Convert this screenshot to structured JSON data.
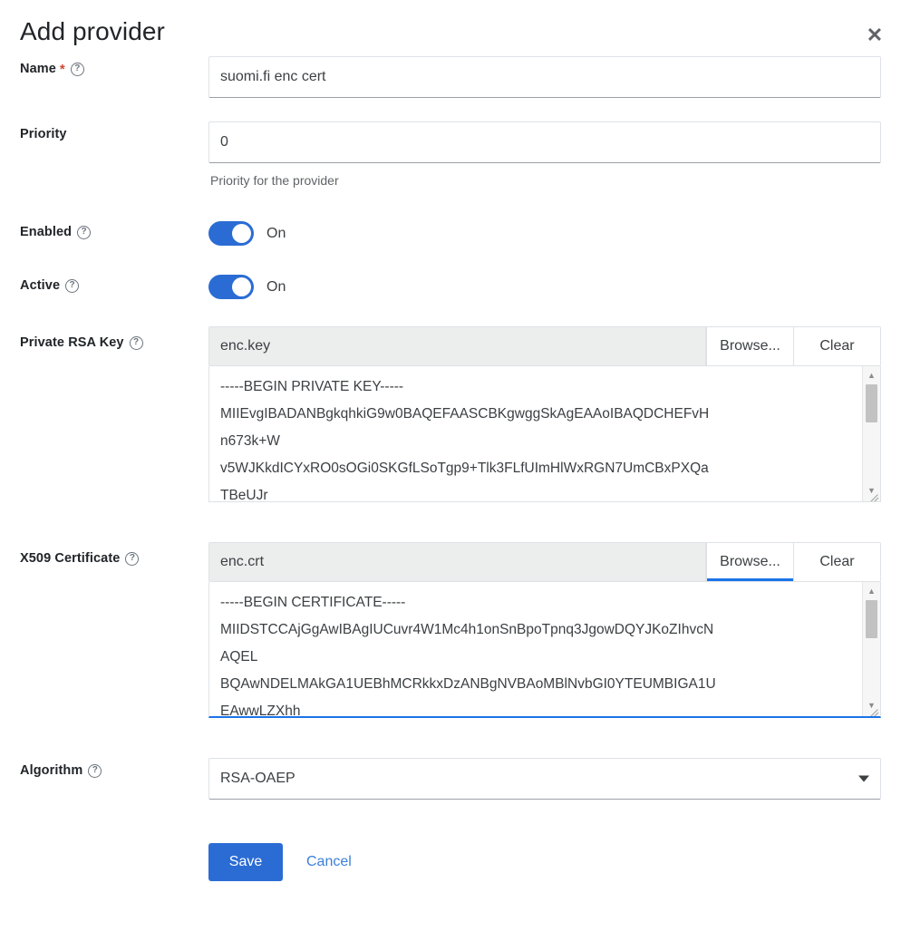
{
  "dialog": {
    "title": "Add provider",
    "close_icon": "close-icon"
  },
  "fields": {
    "name": {
      "label": "Name",
      "required_marker": "*",
      "help_icon": "help-circle-icon",
      "value": "suomi.fi enc cert"
    },
    "priority": {
      "label": "Priority",
      "value": "0",
      "hint": "Priority for the provider"
    },
    "enabled": {
      "label": "Enabled",
      "help_icon": "help-circle-icon",
      "state_label": "On",
      "checked": true
    },
    "active": {
      "label": "Active",
      "help_icon": "help-circle-icon",
      "state_label": "On",
      "checked": true
    },
    "private_rsa_key": {
      "label": "Private RSA Key",
      "help_icon": "help-circle-icon",
      "file_name": "enc.key",
      "browse_label": "Browse...",
      "clear_label": "Clear",
      "content": "-----BEGIN PRIVATE KEY-----\nMIIEvgIBADANBgkqhkiG9w0BAQEFAASCBKgwggSkAgEAAoIBAQDCHEFvH\nn673k+W\nv5WJKkdICYxRO0sOGi0SKGfLSoTgp9+Tlk3FLfUImHlWxRGN7UmCBxPXQa\nTBeUJr"
    },
    "x509_certificate": {
      "label": "X509 Certificate",
      "help_icon": "help-circle-icon",
      "file_name": "enc.crt",
      "browse_label": "Browse...",
      "clear_label": "Clear",
      "content": "-----BEGIN CERTIFICATE-----\nMIIDSTCCAjGgAwIBAgIUCuvr4W1Mc4h1onSnBpoTpnq3JgowDQYJKoZIhvcN\nAQEL\nBQAwNDELMAkGA1UEBhMCRkkxDzANBgNVBAoMBlNvbGI0YTEUMBIGA1U\nEAwwLZXhh"
    },
    "algorithm": {
      "label": "Algorithm",
      "help_icon": "help-circle-icon",
      "value": "RSA-OAEP",
      "caret_icon": "chevron-down-icon"
    }
  },
  "footer": {
    "save_label": "Save",
    "cancel_label": "Cancel"
  },
  "colors": {
    "accent_blue": "#2b6cd4",
    "focus_blue": "#1a73e8",
    "link_blue": "#3c7fd8",
    "required_red": "#d14836"
  }
}
